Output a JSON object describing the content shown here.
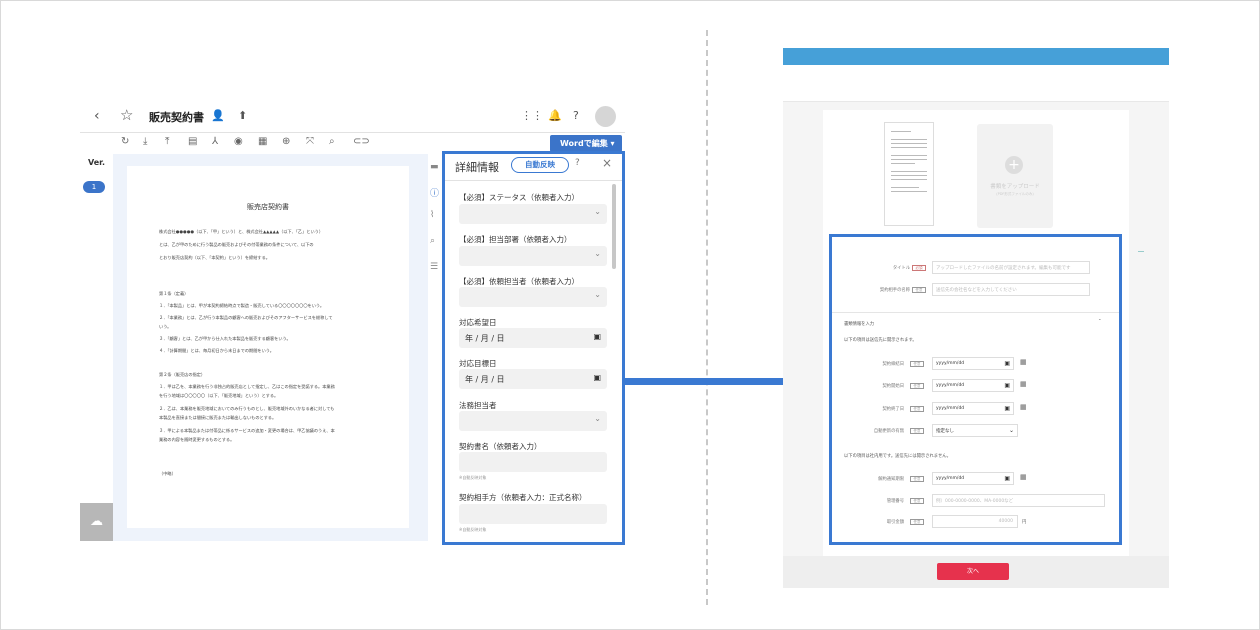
{
  "left_app": {
    "title": "販売契約書",
    "word_button": "Wordで編集",
    "version_label": "Ver.",
    "version_number": "1",
    "document": {
      "heading": "販売店契約書",
      "lines": [
        "株式会社●●●●●（以下、「甲」という）と、株式会社▲▲▲▲▲（以下、「乙」という）",
        "とは、乙が甲のために行う製品の販売およびその付帯業務の条件について、以下の",
        "とおり販売店契約（以下、「本契約」という）を締結する。",
        "第１条（定義）",
        "１．「本製品」とは、甲が本契約締結時点で製造・販売している〇〇〇〇〇〇〇をいう。",
        "２．「本業務」とは、乙が行う本製品の顧客への販売およびそのアフターサービスを総称して",
        "いう。",
        "３．「顧客」とは、乙が甲から仕入れた本製品を販売する顧客をいう。",
        "４．「計算期間」とは、毎月初日から末日までの期間をいう。",
        "第２条（販売店の指定）",
        "１．甲は乙を、本業務を行う非独占的販売店として指定し、乙はこの指定を受諾する。本業務",
        "を行う地域は〇〇〇〇〇（以下、「販売地域」という）とする。",
        "２．乙は、本業務を販売地域においてのみ行うものとし、販売地域外のいかなる者に対しても",
        "本製品を直接または間接に販売または輸出しないものとする。",
        "３．甲による本製品または付帯品に係るサービスの追加・変更の場合は、甲乙協議のうえ、本",
        "業務の内容を随時変更するものとする。",
        "（中略）"
      ]
    },
    "panel": {
      "title": "詳細情報",
      "auto_button": "自動反映",
      "fields": [
        {
          "label": "【必須】ステータス（依頼者入力）",
          "value": ""
        },
        {
          "label": "【必須】担当部署（依頼者入力）",
          "value": ""
        },
        {
          "label": "【必須】依頼担当者（依頼者入力）",
          "value": ""
        },
        {
          "label": "対応希望日",
          "value": "年 / 月 / 日"
        },
        {
          "label": "対応目標日",
          "value": "年 / 月 / 日"
        },
        {
          "label": "法務担当者",
          "value": ""
        },
        {
          "label": "契約書名（依頼者入力）",
          "value": ""
        },
        {
          "label": "契約相手方（依頼者入力：正式名称）",
          "value": ""
        }
      ],
      "note": "※自動反映対象"
    }
  },
  "right_app": {
    "upload_title": "書類をアップロード",
    "upload_sub": "(PDF形式ファイルのみ)",
    "title_label": "タイトル",
    "title_placeholder": "アップロードしたファイルの名前が設定されます。編集も可能です",
    "party_label": "契約相手の名称",
    "party_placeholder": "送信先の会社名などを入力してください",
    "section_title": "書類情報を入力",
    "note1": "以下の項目は送信先に開示されます。",
    "date1_label": "契約締結日",
    "date2_label": "契約開始日",
    "date3_label": "契約終了日",
    "renew_label": "自動更新の有無",
    "renew_value": "指定なし",
    "note2": "以下の項目は社内用です。送信先には開示されません。",
    "cancel_label": "解約通知期限",
    "mgmt_label": "管理番号",
    "mgmt_placeholder": "例）000-0000-0000、MA-0000など",
    "amount_label": "取引金額",
    "amount_value": "40000",
    "amount_unit": "円",
    "date_value": "yyyy/mm/dd",
    "required_tag": "必須",
    "optional_tag": "任意",
    "next_button": "次へ"
  }
}
